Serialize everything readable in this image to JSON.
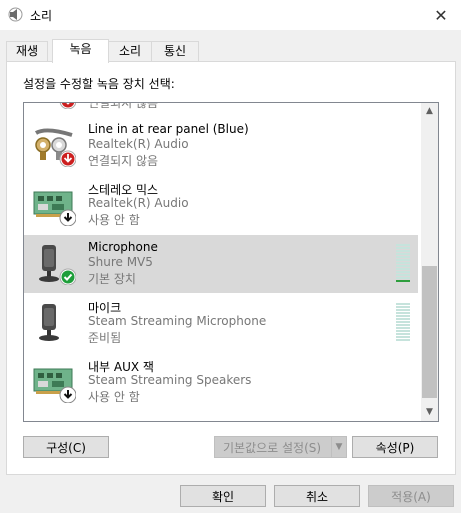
{
  "window": {
    "title": "소리",
    "close_glyph": "✕"
  },
  "tabs": [
    {
      "label": "재생",
      "active": false
    },
    {
      "label": "녹음",
      "active": true
    },
    {
      "label": "소리",
      "active": false
    },
    {
      "label": "통신",
      "active": false
    }
  ],
  "instruction": "설정을 수정할 녹음 장치 선택:",
  "devices": [
    {
      "name": "",
      "description": "",
      "status": "연결되지 않음",
      "icon": "line-in-jack-icon",
      "badge": "red-down-arrow",
      "selected": false,
      "meter_level": null
    },
    {
      "name": "Line in at rear panel (Blue)",
      "description": "Realtek(R) Audio",
      "status": "연결되지 않음",
      "icon": "line-in-jack-icon",
      "badge": "red-down-arrow",
      "selected": false,
      "meter_level": null
    },
    {
      "name": "스테레오 믹스",
      "description": "Realtek(R) Audio",
      "status": "사용 안 함",
      "icon": "sound-card-icon",
      "badge": "black-down-arrow",
      "selected": false,
      "meter_level": null
    },
    {
      "name": "Microphone",
      "description": "Shure MV5",
      "status": "기본 장치",
      "icon": "microphone-icon",
      "badge": "green-check",
      "selected": true,
      "meter_level": 0.05
    },
    {
      "name": "마이크",
      "description": "Steam Streaming Microphone",
      "status": "준비됨",
      "icon": "microphone-icon",
      "badge": "none",
      "selected": false,
      "meter_level": 0
    },
    {
      "name": "내부 AUX 잭",
      "description": "Steam Streaming Speakers",
      "status": "사용 안 함",
      "icon": "sound-card-icon",
      "badge": "black-down-arrow",
      "selected": false,
      "meter_level": null
    }
  ],
  "buttons": {
    "configure": "구성(C)",
    "set_default": "기본값으로 설정(S)",
    "properties": "속성(P)",
    "ok": "확인",
    "cancel": "취소",
    "apply": "적용(A)"
  },
  "colors": {
    "selection": "#d9d9d9",
    "meter_active": "#2e9e3e",
    "meter_inactive": "#c6e3dc",
    "badge_red": "#cc1f1f",
    "badge_green": "#1e9e3a"
  }
}
